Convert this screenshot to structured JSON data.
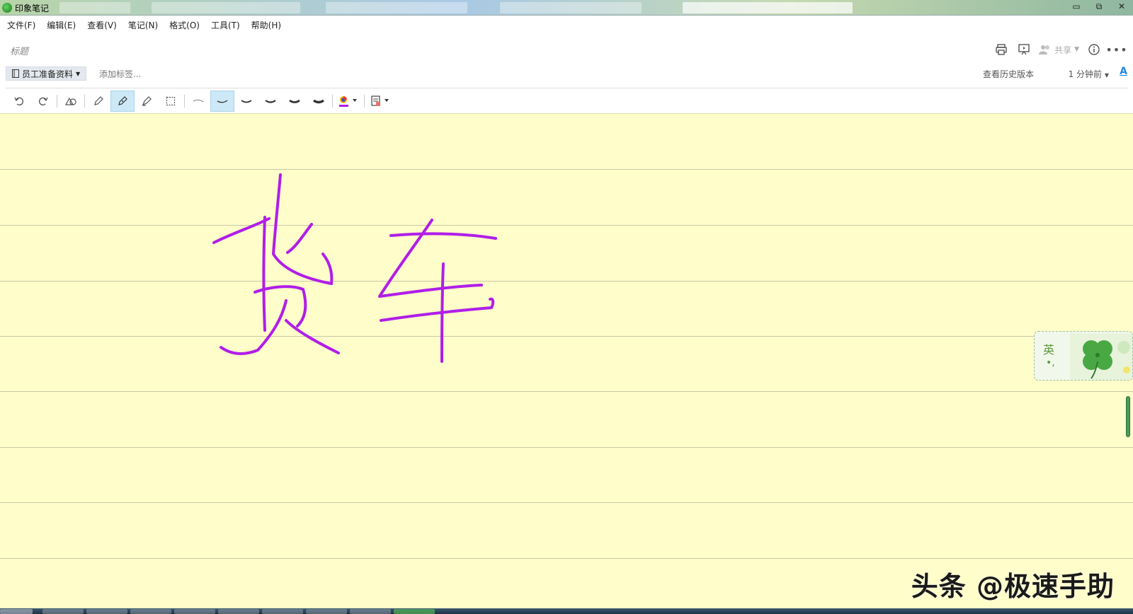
{
  "window": {
    "title": "印象笔记",
    "controls": {
      "minimize": "▭",
      "restore": "⧉",
      "close": "✕"
    }
  },
  "menu": {
    "items": [
      "文件(F)",
      "编辑(E)",
      "查看(V)",
      "笔记(N)",
      "格式(O)",
      "工具(T)",
      "帮助(H)"
    ]
  },
  "note": {
    "title_placeholder": "标题",
    "notebook": "员工准备资料",
    "add_tag_placeholder": "添加标签...",
    "history_label": "查看历史版本",
    "last_saved": "1 分钟前",
    "font_icon_label": "A",
    "share_label": "共享"
  },
  "toolbar": {
    "tools": [
      "undo-icon",
      "redo-icon",
      "shapes-icon",
      "pencil-icon",
      "pen-icon",
      "highlighter-icon",
      "selection-icon",
      "stroke-1-icon",
      "stroke-2-icon",
      "stroke-3-icon",
      "stroke-4-icon",
      "stroke-5-icon",
      "stroke-6-icon",
      "color-picker-icon",
      "paper-style-icon"
    ],
    "active_tool": "pen-icon",
    "active_stroke": "stroke-2-icon",
    "ink_color": "#b01ee8"
  },
  "ime": {
    "language": "英",
    "punctuation": "•,"
  },
  "colors": {
    "paper": "#fffdca",
    "rule": "#c9c7a8",
    "ink": "#b01ee8",
    "accent": "#1e88e5"
  },
  "watermark": "头条 @极速手助"
}
